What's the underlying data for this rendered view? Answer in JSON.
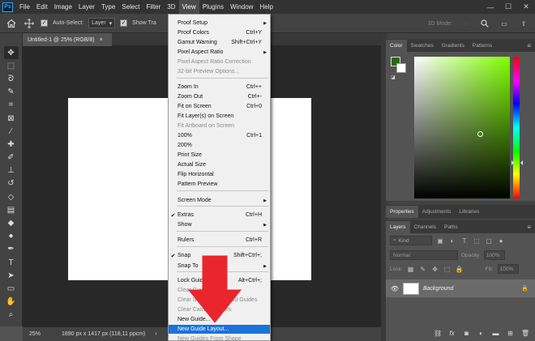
{
  "app": {
    "logo": "Ps"
  },
  "menubar": {
    "items": [
      "File",
      "Edit",
      "Image",
      "Layer",
      "Type",
      "Select",
      "Filter",
      "3D",
      "View",
      "Plugins",
      "Window",
      "Help"
    ],
    "active": "View"
  },
  "window_controls": {
    "minimize": "—",
    "maximize": "☐",
    "close": "✕"
  },
  "options": {
    "auto_select_label": "Auto-Select:",
    "auto_select_value": "Layer",
    "show_transform_label": "Show Tra",
    "mode_3d_label": "3D Mode:"
  },
  "document": {
    "tab_title": "Untitled-1 @ 25% (RGB/8)",
    "tab_close": "×"
  },
  "statusbar": {
    "zoom": "25%",
    "info": "1890 px x 1417 px (118,11 ppcm)"
  },
  "toolbar": {
    "tools": [
      "move-tool",
      "marquee-tool",
      "lasso-tool",
      "quick-select-tool",
      "crop-tool",
      "frame-tool",
      "eyedropper-tool",
      "healing-brush-tool",
      "brush-tool",
      "clone-stamp-tool",
      "history-brush-tool",
      "eraser-tool",
      "gradient-tool",
      "blur-tool",
      "dodge-tool",
      "pen-tool",
      "type-tool",
      "path-select-tool",
      "rectangle-tool",
      "hand-tool",
      "zoom-tool"
    ]
  },
  "color_panel": {
    "tabs": [
      "Color",
      "Swatches",
      "Gradients",
      "Patterns"
    ],
    "active_tab": "Color",
    "foreground_color": "#2a6b04",
    "background_color": "#ffffff"
  },
  "properties_panel": {
    "tabs": [
      "Properties",
      "Adjustments",
      "Libraries"
    ],
    "active_tab": "Properties"
  },
  "layers_panel": {
    "tabs": [
      "Layers",
      "Channels",
      "Paths"
    ],
    "active_tab": "Layers",
    "kind_label": "Kind",
    "blend_mode": "Normal",
    "opacity_label": "Opacity:",
    "opacity_value": "100%",
    "lock_label": "Lock:",
    "fill_label": "Fill:",
    "fill_value": "100%",
    "layer_name": "Background"
  },
  "view_menu": {
    "items": [
      {
        "label": "Proof Setup",
        "shortcut": "",
        "submenu": true,
        "disabled": false,
        "checked": false
      },
      {
        "label": "Proof Colors",
        "shortcut": "Ctrl+Y",
        "submenu": false,
        "disabled": false,
        "checked": false
      },
      {
        "label": "Gamut Warning",
        "shortcut": "Shift+Ctrl+Y",
        "submenu": false,
        "disabled": false,
        "checked": false
      },
      {
        "label": "Pixel Aspect Ratio",
        "shortcut": "",
        "submenu": true,
        "disabled": false,
        "checked": false
      },
      {
        "label": "Pixel Aspect Ratio Correction",
        "shortcut": "",
        "submenu": false,
        "disabled": true,
        "checked": false
      },
      {
        "label": "32-bit Preview Options...",
        "shortcut": "",
        "submenu": false,
        "disabled": true,
        "checked": false
      },
      {
        "label": "Zoom In",
        "shortcut": "Ctrl++",
        "submenu": false,
        "disabled": false,
        "checked": false
      },
      {
        "label": "Zoom Out",
        "shortcut": "Ctrl+-",
        "submenu": false,
        "disabled": false,
        "checked": false
      },
      {
        "label": "Fit on Screen",
        "shortcut": "Ctrl+0",
        "submenu": false,
        "disabled": false,
        "checked": false
      },
      {
        "label": "Fit Layer(s) on Screen",
        "shortcut": "",
        "submenu": false,
        "disabled": false,
        "checked": false
      },
      {
        "label": "Fit Artboard on Screen",
        "shortcut": "",
        "submenu": false,
        "disabled": true,
        "checked": false
      },
      {
        "label": "100%",
        "shortcut": "Ctrl+1",
        "submenu": false,
        "disabled": false,
        "checked": false
      },
      {
        "label": "200%",
        "shortcut": "",
        "submenu": false,
        "disabled": false,
        "checked": false
      },
      {
        "label": "Print Size",
        "shortcut": "",
        "submenu": false,
        "disabled": false,
        "checked": false
      },
      {
        "label": "Actual Size",
        "shortcut": "",
        "submenu": false,
        "disabled": false,
        "checked": false
      },
      {
        "label": "Flip Horizontal",
        "shortcut": "",
        "submenu": false,
        "disabled": false,
        "checked": false
      },
      {
        "label": "Pattern Preview",
        "shortcut": "",
        "submenu": false,
        "disabled": false,
        "checked": false
      },
      {
        "label": "Screen Mode",
        "shortcut": "",
        "submenu": true,
        "disabled": false,
        "checked": false
      },
      {
        "label": "Extras",
        "shortcut": "Ctrl+H",
        "submenu": false,
        "disabled": false,
        "checked": true
      },
      {
        "label": "Show",
        "shortcut": "",
        "submenu": true,
        "disabled": false,
        "checked": false
      },
      {
        "label": "Rulers",
        "shortcut": "Ctrl+R",
        "submenu": false,
        "disabled": false,
        "checked": false
      },
      {
        "label": "Snap",
        "shortcut": "Shift+Ctrl+;",
        "submenu": false,
        "disabled": false,
        "checked": true
      },
      {
        "label": "Snap To",
        "shortcut": "",
        "submenu": true,
        "disabled": false,
        "checked": false
      },
      {
        "label": "Lock Guides",
        "shortcut": "Alt+Ctrl+;",
        "submenu": false,
        "disabled": false,
        "checked": false
      },
      {
        "label": "Clear Guides",
        "shortcut": "",
        "submenu": false,
        "disabled": true,
        "checked": false
      },
      {
        "label": "Clear Selected Artboard Guides",
        "shortcut": "",
        "submenu": false,
        "disabled": true,
        "checked": false
      },
      {
        "label": "Clear Canvas Guides",
        "shortcut": "",
        "submenu": false,
        "disabled": true,
        "checked": false
      },
      {
        "label": "New Guide...",
        "shortcut": "",
        "submenu": false,
        "disabled": false,
        "checked": false
      },
      {
        "label": "New Guide Layout...",
        "shortcut": "",
        "submenu": false,
        "disabled": false,
        "checked": false,
        "highlighted": true
      },
      {
        "label": "New Guides From Shape",
        "shortcut": "",
        "submenu": false,
        "disabled": true,
        "checked": false
      }
    ]
  }
}
